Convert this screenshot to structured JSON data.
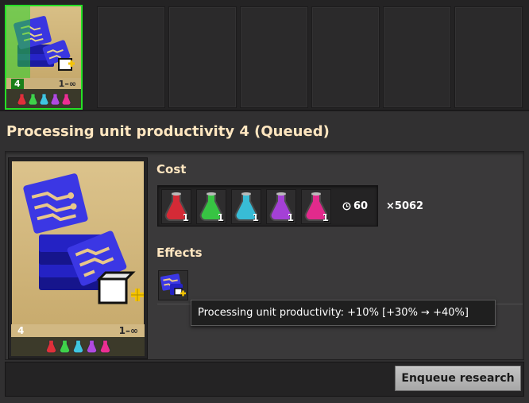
{
  "queue": {
    "active": {
      "level": "4",
      "range": "1–∞",
      "progress_fraction": 0.33
    },
    "empty_slot_count": 6
  },
  "page_title": "Processing unit productivity 4 (Queued)",
  "tech_card": {
    "level": "4",
    "range": "1–∞",
    "icon": "processing-unit-productivity-icon"
  },
  "cost": {
    "label": "Cost",
    "packs": [
      {
        "name": "automation-science-pack",
        "color": "#e0303a",
        "count": "1"
      },
      {
        "name": "logistic-science-pack",
        "color": "#3fd24a",
        "count": "1"
      },
      {
        "name": "chemical-science-pack",
        "color": "#3fc6e0",
        "count": "1"
      },
      {
        "name": "production-science-pack",
        "color": "#b04ae0",
        "count": "1"
      },
      {
        "name": "utility-science-pack",
        "color": "#ec2e93",
        "count": "1"
      }
    ],
    "time": "60",
    "time_icon": "clock-icon",
    "multiplier": "×5062"
  },
  "effects": {
    "label": "Effects",
    "tooltip": "Processing unit productivity: +10% [+30% → +40%]"
  },
  "buttons": {
    "enqueue": "Enqueue research"
  },
  "colors": {
    "progress": "#28d228",
    "heading": "#ffe6c0",
    "card_bg": "#d2b985"
  }
}
